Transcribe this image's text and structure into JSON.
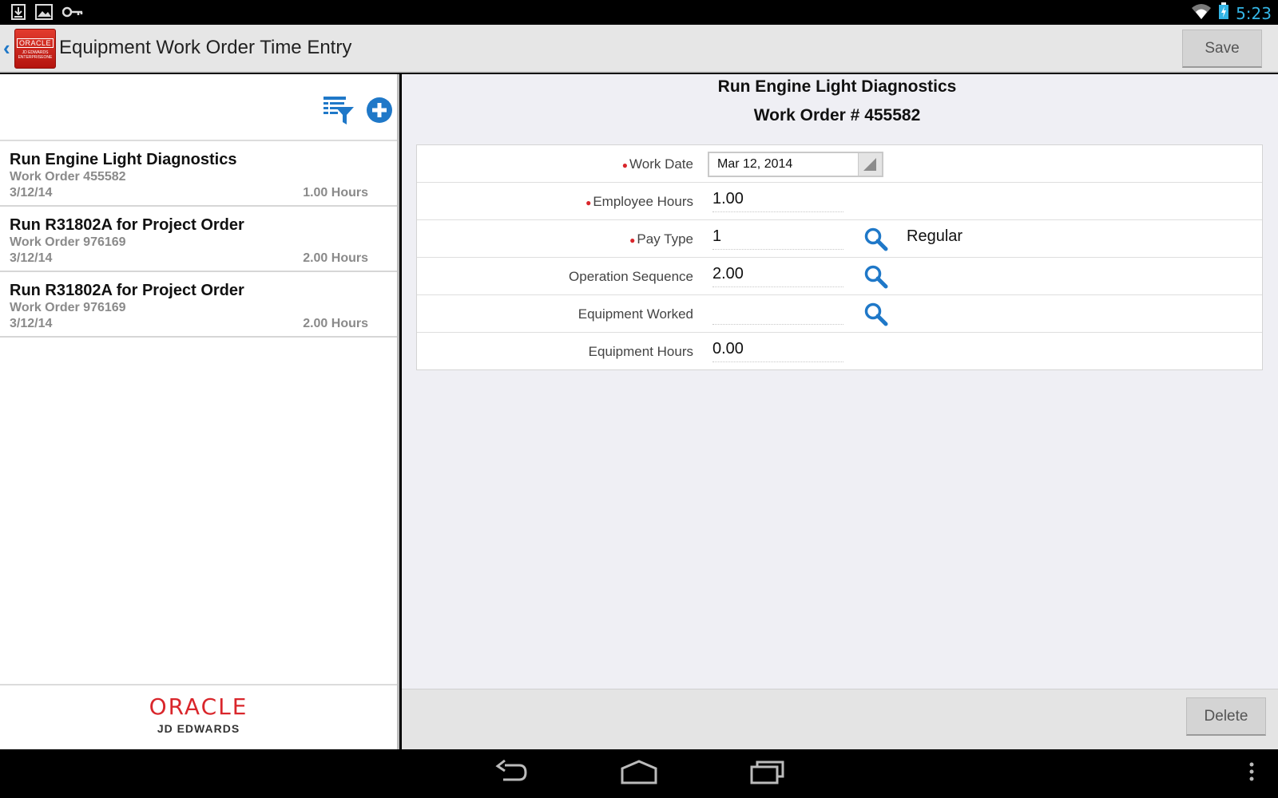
{
  "status_bar": {
    "time": "5:23",
    "left_icons": [
      "download-icon",
      "image-icon",
      "key-icon"
    ],
    "right_icons": [
      "wifi-icon",
      "battery-charging-icon"
    ]
  },
  "action_bar": {
    "title": "Equipment Work Order Time Entry",
    "logo_text": "ORACLE",
    "logo_sub1": "JD EDWARDS",
    "logo_sub2": "ENTERPRISEONE",
    "save_label": "Save"
  },
  "list": {
    "items": [
      {
        "title": "Run Engine Light Diagnostics",
        "work_order": "Work Order 455582",
        "date": "3/12/14",
        "hours": "1.00 Hours"
      },
      {
        "title": "Run R31802A for Project Order",
        "work_order": "Work Order 976169",
        "date": "3/12/14",
        "hours": "2.00 Hours"
      },
      {
        "title": "Run R31802A for Project Order",
        "work_order": "Work Order 976169",
        "date": "3/12/14",
        "hours": "2.00 Hours"
      }
    ],
    "footer_brand": "ORACLE",
    "footer_sub": "JD EDWARDS"
  },
  "detail": {
    "title": "Run Engine Light Diagnostics",
    "subtitle": "Work Order # 455582",
    "fields": {
      "work_date": {
        "label": "Work Date",
        "value": "Mar 12, 2014",
        "required": true
      },
      "employee_hours": {
        "label": "Employee Hours",
        "value": "1.00",
        "required": true
      },
      "pay_type": {
        "label": "Pay Type",
        "value": "1",
        "description": "Regular",
        "required": true
      },
      "operation_sequence": {
        "label": "Operation Sequence",
        "value": "2.00"
      },
      "equipment_worked": {
        "label": "Equipment Worked",
        "value": ""
      },
      "equipment_hours": {
        "label": "Equipment Hours",
        "value": "0.00"
      }
    },
    "delete_label": "Delete"
  },
  "colors": {
    "accent_blue": "#1f78c8",
    "oracle_red": "#d9262b",
    "status_time": "#34b5e5"
  }
}
